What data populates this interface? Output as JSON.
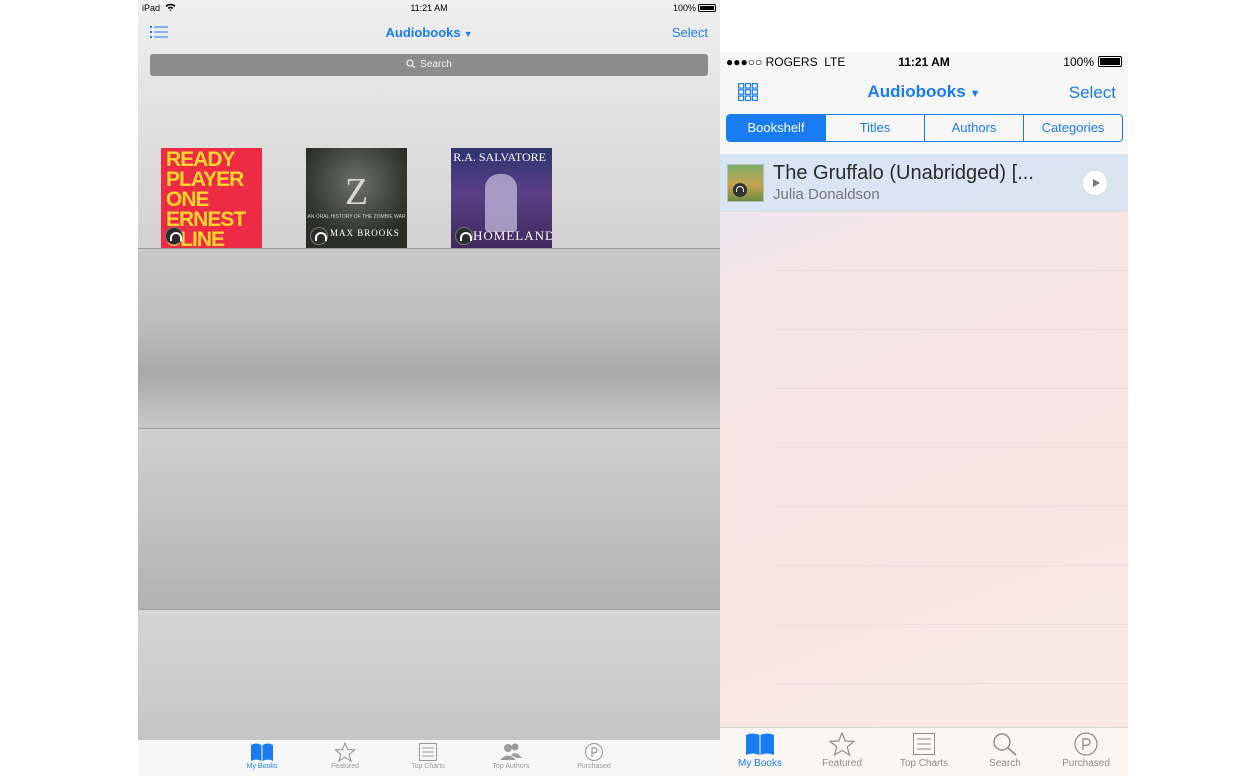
{
  "ipad": {
    "status": {
      "device": "iPad",
      "time": "11:21 AM",
      "battery": "100%"
    },
    "nav": {
      "title": "Audiobooks",
      "select_label": "Select"
    },
    "search": {
      "placeholder": "Search"
    },
    "books": [
      {
        "cover_text": "READY PLAYER ONE ERNEST CLINE"
      },
      {
        "cover_text": "Z",
        "cover_sub": "AN ORAL HISTORY OF THE ZOMBIE WAR",
        "author": "MAX BROOKS"
      },
      {
        "cover_text": "HOMELAND",
        "author": "R.A. SALVATORE"
      }
    ],
    "tabs": [
      {
        "label": "My Books",
        "icon": "book-icon"
      },
      {
        "label": "Featured",
        "icon": "star-icon"
      },
      {
        "label": "Top Charts",
        "icon": "list-icon"
      },
      {
        "label": "Top Authors",
        "icon": "people-icon"
      },
      {
        "label": "Purchased",
        "icon": "purchased-icon"
      }
    ],
    "active_tab": "My Books"
  },
  "iphone": {
    "status": {
      "carrier": "●●●○○ ROGERS",
      "network": "LTE",
      "time": "11:21 AM",
      "battery": "100%"
    },
    "nav": {
      "title": "Audiobooks",
      "select_label": "Select"
    },
    "segments": [
      "Bookshelf",
      "Titles",
      "Authors",
      "Categories"
    ],
    "selected_segment": "Bookshelf",
    "items": [
      {
        "title": "The Gruffalo (Unabridged) [...",
        "author": "Julia Donaldson"
      }
    ],
    "tabs": [
      {
        "label": "My Books",
        "icon": "book-icon"
      },
      {
        "label": "Featured",
        "icon": "star-icon"
      },
      {
        "label": "Top Charts",
        "icon": "list-icon"
      },
      {
        "label": "Search",
        "icon": "search-icon"
      },
      {
        "label": "Purchased",
        "icon": "purchased-icon"
      }
    ],
    "active_tab": "My Books",
    "colors": {
      "accent": "#1a7cf4"
    }
  }
}
